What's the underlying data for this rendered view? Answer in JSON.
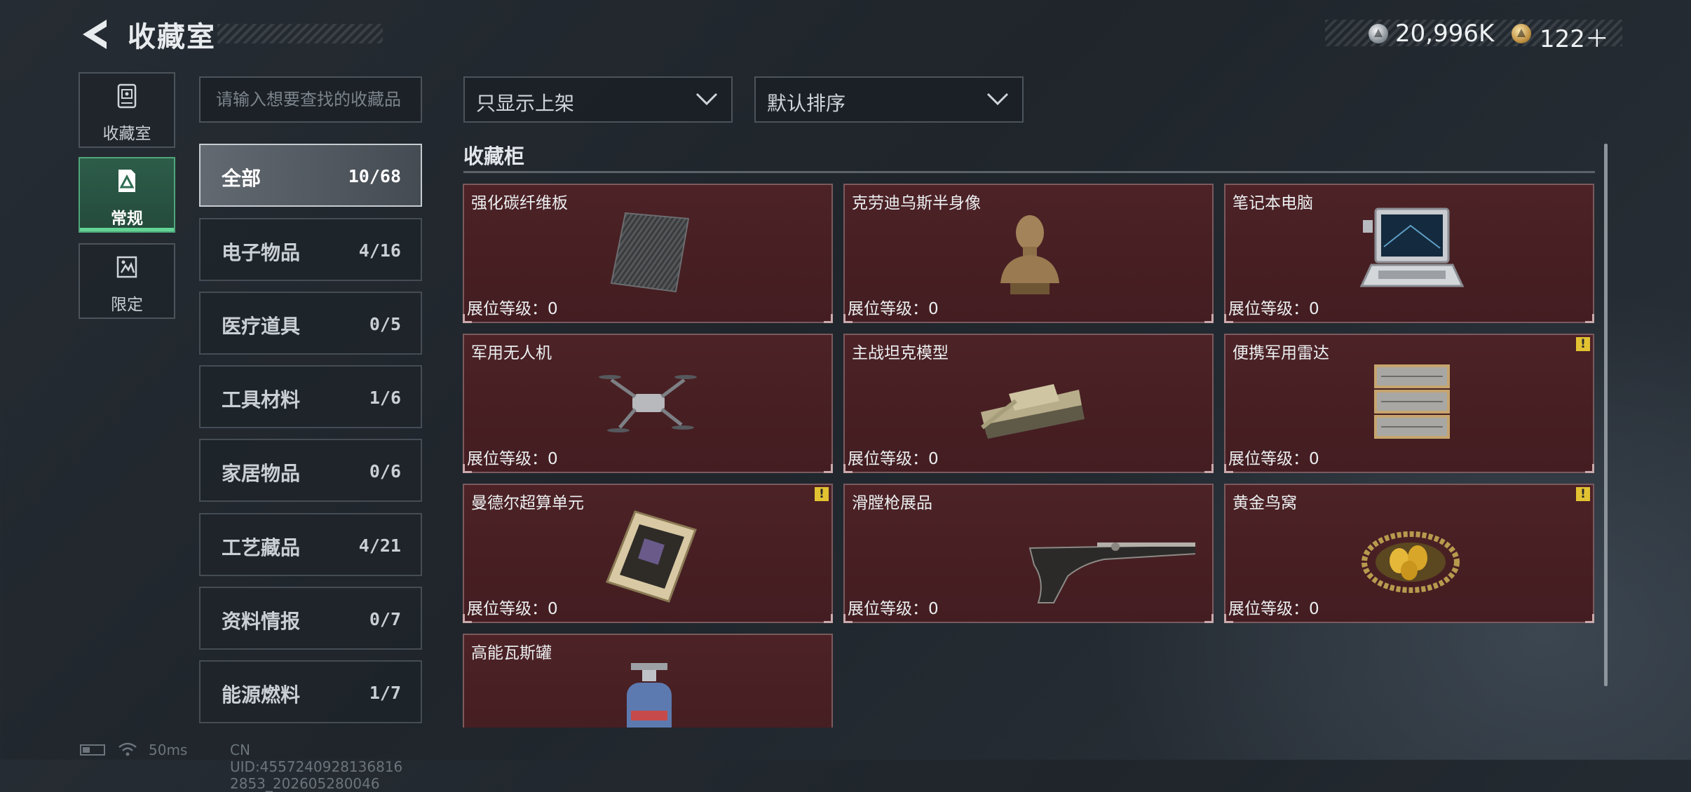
{
  "header": {
    "title": "收藏室",
    "silver_currency": "20,996K",
    "gold_currency": "122＋"
  },
  "sidebar": {
    "items": [
      {
        "label": "收藏室",
        "icon": "display-case-icon"
      },
      {
        "label": "常规",
        "icon": "regular-card-icon",
        "selected": true
      },
      {
        "label": "限定",
        "icon": "limited-card-icon"
      }
    ]
  },
  "search": {
    "placeholder": "请输入想要查找的收藏品",
    "value": ""
  },
  "categories": [
    {
      "name": "全部",
      "count": "10/68",
      "active": true
    },
    {
      "name": "电子物品",
      "count": "4/16"
    },
    {
      "name": "医疗道具",
      "count": "0/5"
    },
    {
      "name": "工具材料",
      "count": "1/6"
    },
    {
      "name": "家居物品",
      "count": "0/6"
    },
    {
      "name": "工艺藏品",
      "count": "4/21"
    },
    {
      "name": "资料情报",
      "count": "0/7"
    },
    {
      "name": "能源燃料",
      "count": "1/7"
    }
  ],
  "filters": {
    "filter_label": "只显示上架",
    "sort_label": "默认排序"
  },
  "cabinet": {
    "title": "收藏柜",
    "items": [
      {
        "name": "强化碳纤维板",
        "level": "展位等级：0",
        "warning": false,
        "icon": "carbon-plate-icon"
      },
      {
        "name": "克劳迪乌斯半身像",
        "level": "展位等级：0",
        "warning": false,
        "icon": "bust-icon"
      },
      {
        "name": "笔记本电脑",
        "level": "展位等级：0",
        "warning": false,
        "icon": "laptop-icon"
      },
      {
        "name": "军用无人机",
        "level": "展位等级：0",
        "warning": false,
        "icon": "drone-icon"
      },
      {
        "name": "主战坦克模型",
        "level": "展位等级：0",
        "warning": false,
        "icon": "tank-icon"
      },
      {
        "name": "便携军用雷达",
        "level": "展位等级：0",
        "warning": true,
        "icon": "radar-icon"
      },
      {
        "name": "曼德尔超算单元",
        "level": "展位等级：0",
        "warning": true,
        "icon": "circuit-board-icon"
      },
      {
        "name": "滑膛枪展品",
        "level": "展位等级：0",
        "warning": false,
        "icon": "musket-icon"
      },
      {
        "name": "黄金鸟窝",
        "level": "展位等级：0",
        "warning": true,
        "icon": "golden-nest-icon"
      },
      {
        "name": "高能瓦斯罐",
        "level": "",
        "warning": false,
        "icon": "gas-tank-icon"
      }
    ]
  },
  "status_bar": {
    "ping": "50ms",
    "uid": "CN UID:4557240928136816 2853_202605280046"
  },
  "colors": {
    "card_bg": "#4a2024",
    "accent_green": "#4fa67a",
    "warning_yellow": "#e2c232"
  }
}
